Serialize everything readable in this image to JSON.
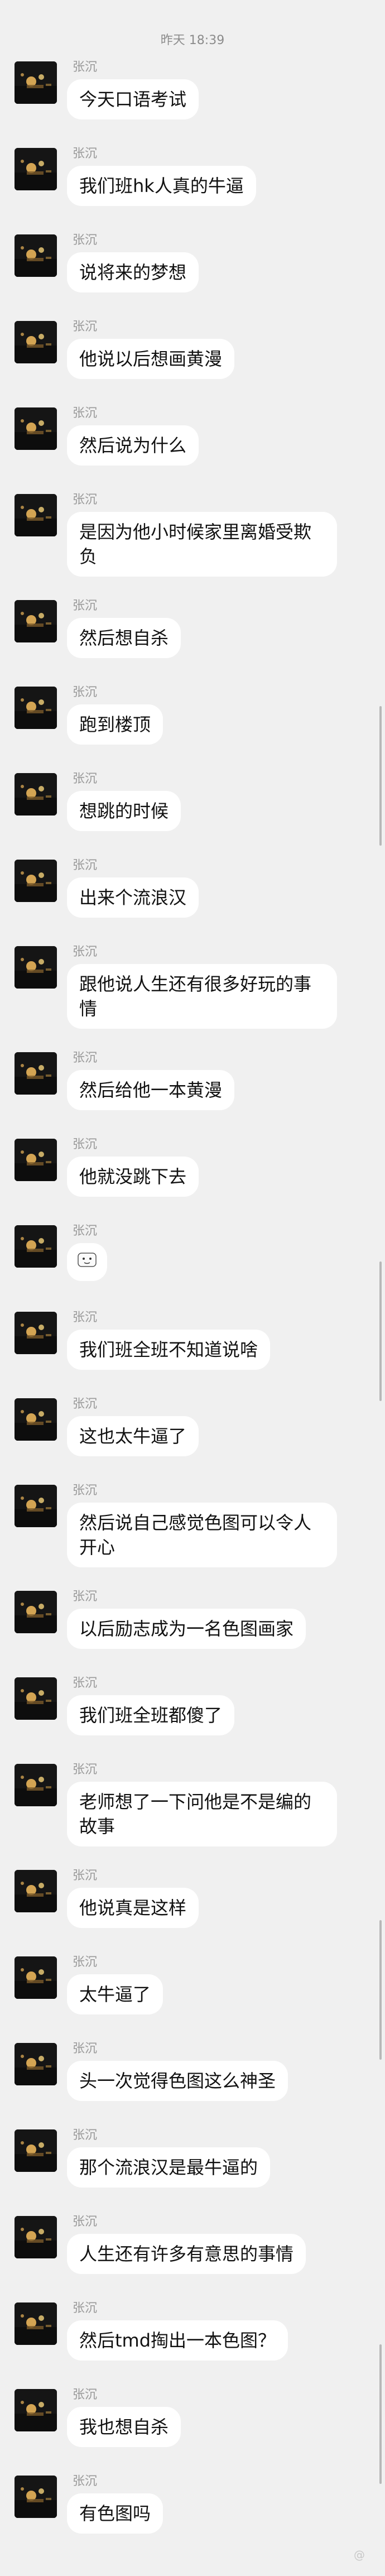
{
  "timestamp": "昨天 18:39",
  "sender_name": "张沉",
  "messages": [
    {
      "text": "今天口语考试"
    },
    {
      "text": "我们班hk人真的牛逼"
    },
    {
      "text": "说将来的梦想"
    },
    {
      "text": "他说以后想画黄漫"
    },
    {
      "text": "然后说为什么"
    },
    {
      "text": "是因为他小时候家里离婚受欺负"
    },
    {
      "text": "然后想自杀"
    },
    {
      "text": "跑到楼顶"
    },
    {
      "text": "想跳的时候"
    },
    {
      "text": "出来个流浪汉"
    },
    {
      "text": "跟他说人生还有很多好玩的事情"
    },
    {
      "text": "然后给他一本黄漫"
    },
    {
      "text": "他就没跳下去"
    },
    {
      "text": "",
      "emoji": "sticker-icon"
    },
    {
      "text": "我们班全班不知道说啥"
    },
    {
      "text": "这也太牛逼了"
    },
    {
      "text": "然后说自己感觉色图可以令人开心"
    },
    {
      "text": "以后励志成为一名色图画家"
    },
    {
      "text": "我们班全班都傻了"
    },
    {
      "text": "老师想了一下问他是不是编的故事"
    },
    {
      "text": "他说真是这样"
    },
    {
      "text": "太牛逼了"
    },
    {
      "text": "头一次觉得色图这么神圣"
    },
    {
      "text": "那个流浪汉是最牛逼的"
    },
    {
      "text": "人生还有许多有意思的事情"
    },
    {
      "text": "然后tmd掏出一本色图？"
    },
    {
      "text": "我也想自杀"
    },
    {
      "text": "有色图吗"
    }
  ],
  "watermark": "@"
}
